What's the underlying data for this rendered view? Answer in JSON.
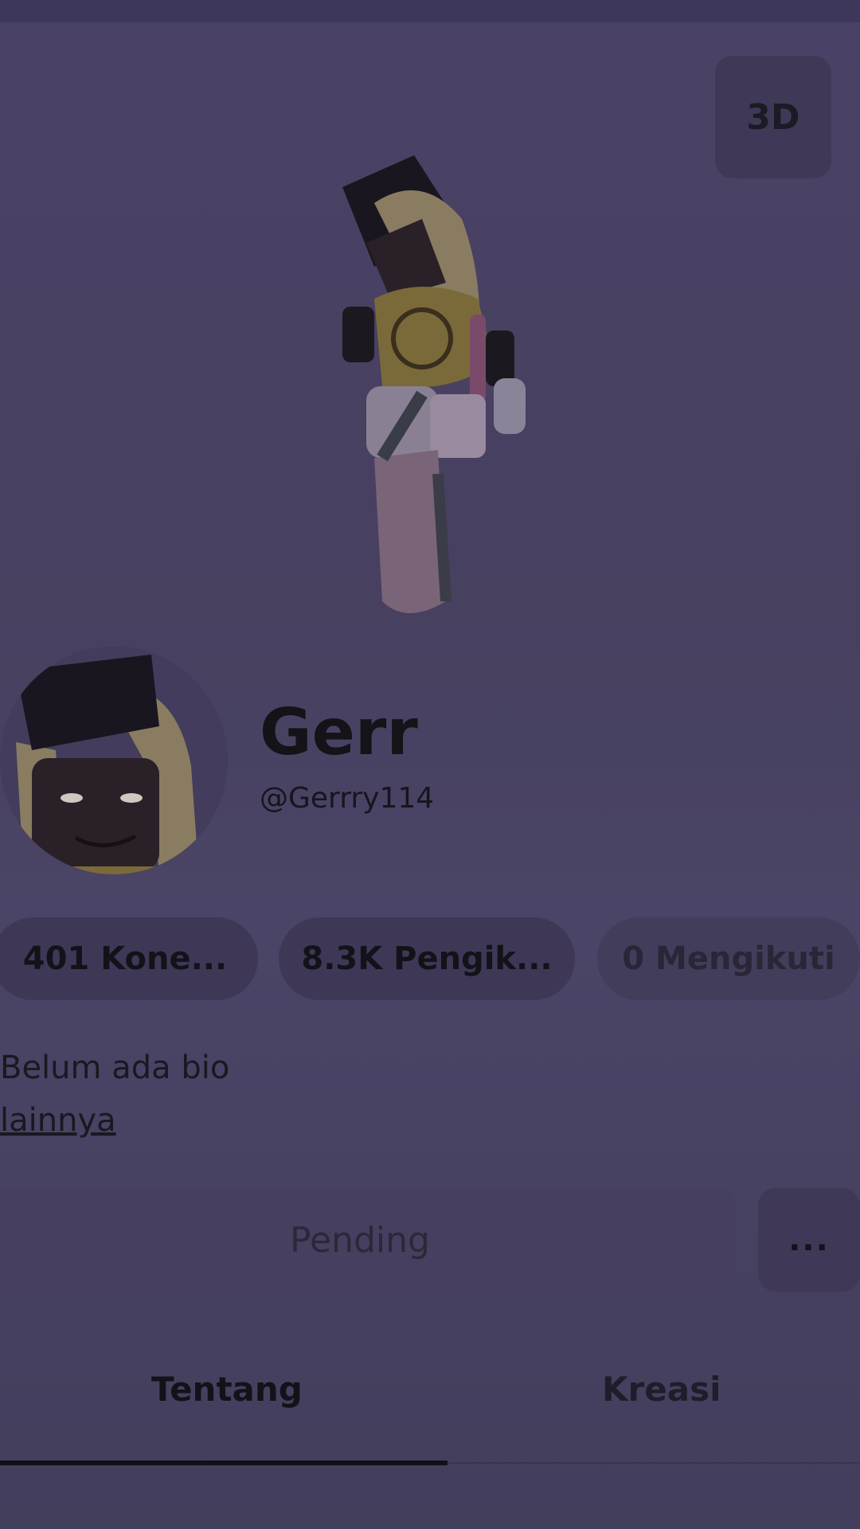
{
  "header": {
    "view_3d_label": "3D"
  },
  "profile": {
    "display_name": "Gerr",
    "username": "@Gerrry114"
  },
  "stats": {
    "connections": "401 Kone...",
    "followers": "8.3K Pengik...",
    "following": "0 Mengikuti"
  },
  "bio": {
    "text": "Belum ada bio",
    "more": "lainnya"
  },
  "actions": {
    "pending": "Pending",
    "more": "..."
  },
  "tabs": [
    {
      "label": "Tentang",
      "active": true
    },
    {
      "label": "Kreasi",
      "active": false
    }
  ],
  "colors": {
    "background": "#47405f",
    "pill": "#3e3856",
    "text": "#141219"
  }
}
